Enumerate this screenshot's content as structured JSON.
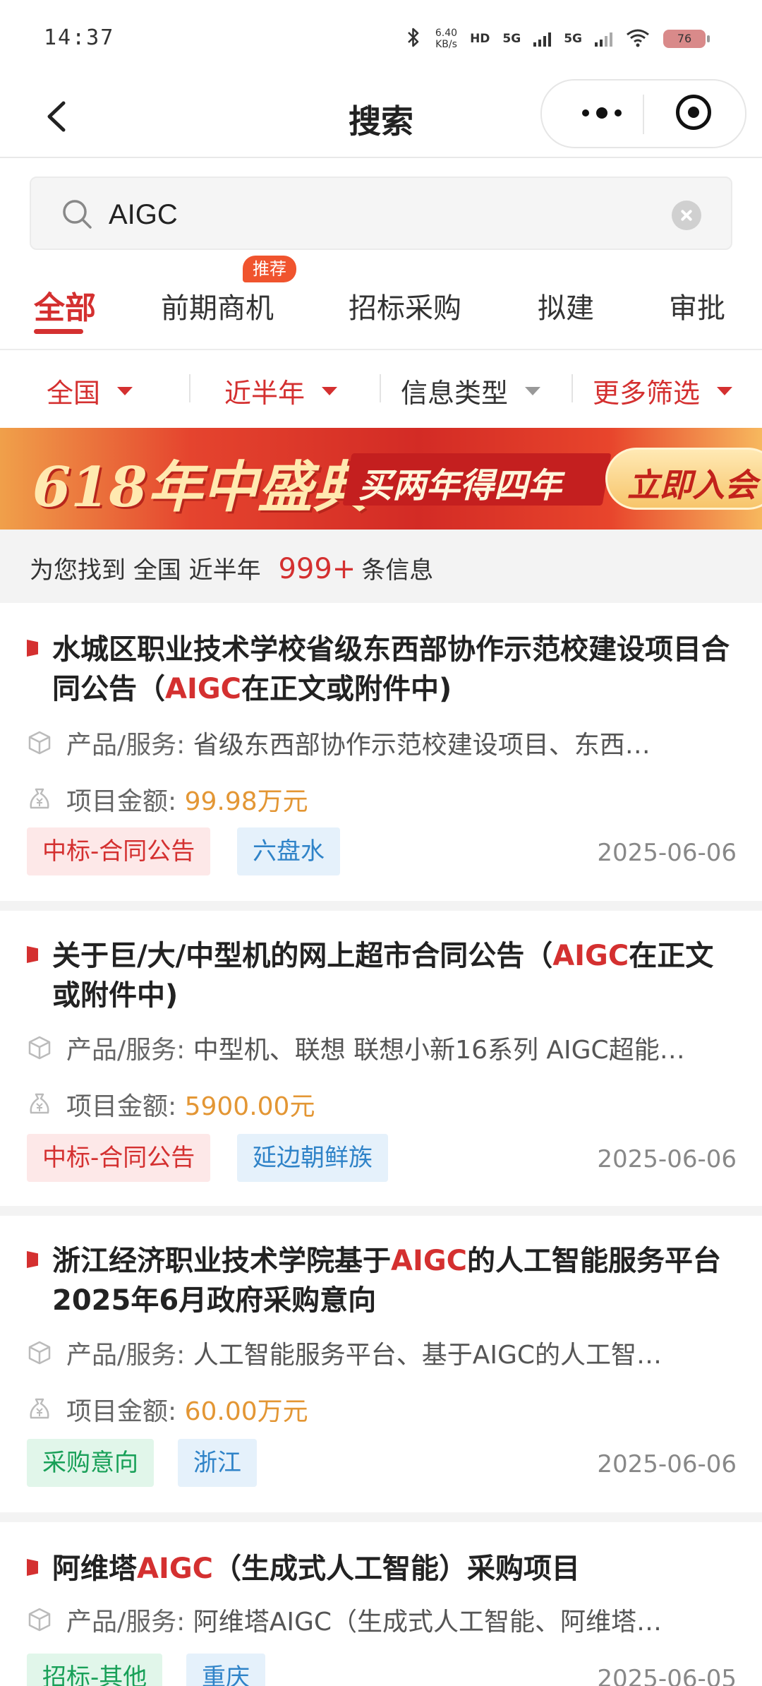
{
  "status_bar": {
    "time": "14:37",
    "net_speed_value": "6.40",
    "net_speed_unit": "KB/s",
    "hd": "HD",
    "sim1": "5G",
    "sim2": "5G",
    "battery": "76"
  },
  "nav": {
    "title": "搜索"
  },
  "search": {
    "value": "AIGC"
  },
  "tabs": {
    "items": [
      "全部",
      "前期商机",
      "招标采购",
      "拟建",
      "审批"
    ],
    "active_index": 0,
    "badge": "推荐"
  },
  "filters": {
    "region": "全国",
    "period": "近半年",
    "info_type": "信息类型",
    "more": "更多筛选"
  },
  "banner": {
    "headline": "618年中盛典",
    "subline": "买两年得四年",
    "cta": "立即入会"
  },
  "summary": {
    "prefix": "为您找到",
    "region": "全国",
    "period": "近半年",
    "count": "999+",
    "suffix": "条信息"
  },
  "labels": {
    "product": "产品/服务:",
    "amount": "项目金额:"
  },
  "results": [
    {
      "title_pre": "水城区职业技术学校省级东西部协作示范校建设项目合同公告（",
      "title_hl": "AIGC",
      "title_post": "在正文或附件中)",
      "product": "省级东西部协作示范校建设项目、东西…",
      "amount": "99.98万元",
      "tags": [
        "中标-合同公告",
        "六盘水"
      ],
      "date": "2025-06-06"
    },
    {
      "title_pre": "关于巨/大/中型机的网上超市合同公告（",
      "title_hl": "AIGC",
      "title_post": "在正文或附件中)",
      "product": "中型机、联想 联想小新16系列 AIGC超能…",
      "amount": "5900.00元",
      "tags": [
        "中标-合同公告",
        "延边朝鲜族"
      ],
      "date": "2025-06-06"
    },
    {
      "title_pre": "浙江经济职业技术学院基于",
      "title_hl": "AIGC",
      "title_post": "的人工智能服务平台2025年6月政府采购意向",
      "product": "人工智能服务平台、基于AIGC的人工智…",
      "amount": "60.00万元",
      "tags": [
        "采购意向",
        "浙江"
      ],
      "date": "2025-06-06"
    },
    {
      "title_pre": "阿维塔",
      "title_hl": "AIGC",
      "title_post": "（生成式人工智能）采购项目",
      "product": "阿维塔AIGC（生成式人工智能、阿维塔…",
      "tags": [
        "招标-其他",
        "重庆"
      ],
      "date": "2025-06-05"
    }
  ],
  "colors": {
    "accent": "#d43030",
    "amount": "#e39634",
    "tag_red_bg": "#fde8e8",
    "tag_blue_bg": "#e5f1fb",
    "tag_green_bg": "#e1f6ea"
  }
}
